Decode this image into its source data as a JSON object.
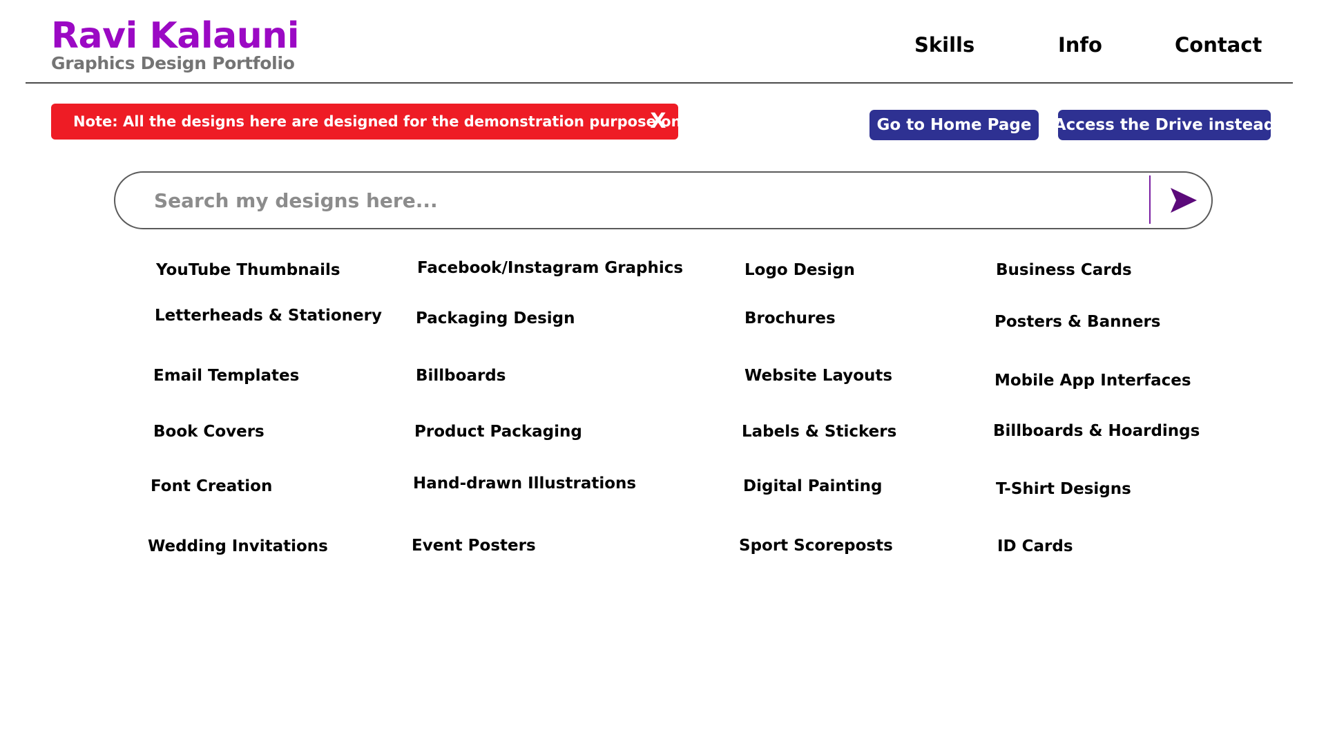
{
  "header": {
    "brand_name": "Ravi Kalauni",
    "brand_subtitle": "Graphics Design Portfolio",
    "nav": [
      "Skills",
      "Info",
      "Contact"
    ]
  },
  "note": {
    "text": "Note: All the designs here are designed for the demonstration purpose only",
    "close_label": "X"
  },
  "buttons": {
    "home": "Go to Home Page",
    "drive": "Access the Drive instead"
  },
  "search": {
    "placeholder": "Search my designs here...",
    "submit_icon": "send-icon"
  },
  "categories": [
    [
      "YouTube Thumbnails",
      "Facebook/Instagram Graphics",
      "Logo Design",
      "Business Cards"
    ],
    [
      "Letterheads & Stationery",
      "Packaging Design",
      "Brochures",
      "Posters & Banners"
    ],
    [
      "Email Templates",
      "Billboards",
      "Website Layouts",
      "Mobile App Interfaces"
    ],
    [
      "Book Covers",
      "Product Packaging",
      "Labels & Stickers",
      "Billboards & Hoardings"
    ],
    [
      "Font Creation",
      "Hand-drawn Illustrations",
      "Digital Painting",
      "T-Shirt Designs"
    ],
    [
      "Wedding Invitations",
      "Event Posters",
      "Sport Scoreposts",
      "ID Cards"
    ]
  ],
  "colors": {
    "brand": "#9b09c4",
    "subtitle": "#747474",
    "note_bg": "#ee1c25",
    "button_bg": "#2e3192",
    "send_icon": "#5b0a7a"
  }
}
